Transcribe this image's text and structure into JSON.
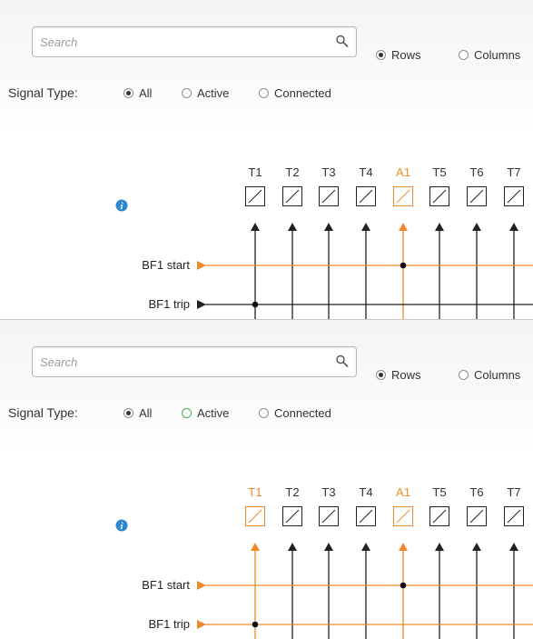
{
  "colors": {
    "accent": "#ee8a2a",
    "black": "#222222",
    "active_green": "#4caf50"
  },
  "panels": [
    {
      "search": {
        "placeholder": "Search",
        "icon": "search-icon"
      },
      "view_mode": {
        "options": [
          "Rows",
          "Columns"
        ],
        "selected": "Rows"
      },
      "signal_type": {
        "label": "Signal Type:",
        "options": [
          "All",
          "Active",
          "Connected"
        ],
        "selected": "All"
      },
      "info_icon": "info-icon",
      "columns": [
        {
          "label": "T1",
          "highlighted": false
        },
        {
          "label": "T2",
          "highlighted": false
        },
        {
          "label": "T3",
          "highlighted": false
        },
        {
          "label": "T4",
          "highlighted": false
        },
        {
          "label": "A1",
          "highlighted": true
        },
        {
          "label": "T5",
          "highlighted": false
        },
        {
          "label": "T6",
          "highlighted": false
        },
        {
          "label": "T7",
          "highlighted": false
        }
      ],
      "rows": [
        {
          "label": "BF1 start",
          "highlighted": true,
          "connections": [
            "A1"
          ]
        },
        {
          "label": "BF1 trip",
          "highlighted": false,
          "connections": [
            "T1"
          ]
        }
      ]
    },
    {
      "search": {
        "placeholder": "Search",
        "icon": "search-icon"
      },
      "view_mode": {
        "options": [
          "Rows",
          "Columns"
        ],
        "selected": "Rows"
      },
      "signal_type": {
        "label": "Signal Type:",
        "options": [
          "All",
          "Active",
          "Connected"
        ],
        "selected": "All"
      },
      "info_icon": "info-icon",
      "columns": [
        {
          "label": "T1",
          "highlighted": true
        },
        {
          "label": "T2",
          "highlighted": false
        },
        {
          "label": "T3",
          "highlighted": false
        },
        {
          "label": "T4",
          "highlighted": false
        },
        {
          "label": "A1",
          "highlighted": true
        },
        {
          "label": "T5",
          "highlighted": false
        },
        {
          "label": "T6",
          "highlighted": false
        },
        {
          "label": "T7",
          "highlighted": false
        }
      ],
      "rows": [
        {
          "label": "BF1 start",
          "highlighted": true,
          "connections": [
            "A1"
          ]
        },
        {
          "label": "BF1 trip",
          "highlighted": true,
          "connections": [
            "T1"
          ]
        }
      ]
    }
  ]
}
